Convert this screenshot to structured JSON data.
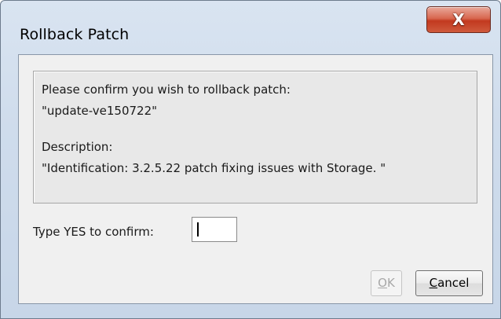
{
  "window": {
    "title": "Rollback Patch",
    "close_glyph": "X"
  },
  "message": {
    "line1": "Please confirm you wish to rollback patch:",
    "line2": "\"update-ve150722\"",
    "line3": "Description:",
    "line4": "\"Identification: 3.2.5.22 patch fixing issues with Storage. \""
  },
  "confirm": {
    "label": "Type YES to confirm:",
    "value": ""
  },
  "buttons": {
    "ok": {
      "mnemonic": "O",
      "rest": "K",
      "enabled": false
    },
    "cancel": {
      "mnemonic": "C",
      "rest": "ancel",
      "enabled": true
    }
  },
  "colors": {
    "close_button": "#c2391f",
    "dialog_bg": "#f0f0f0",
    "disabled_text": "#a8a8a8"
  },
  "icons": {
    "close": "close-icon"
  }
}
